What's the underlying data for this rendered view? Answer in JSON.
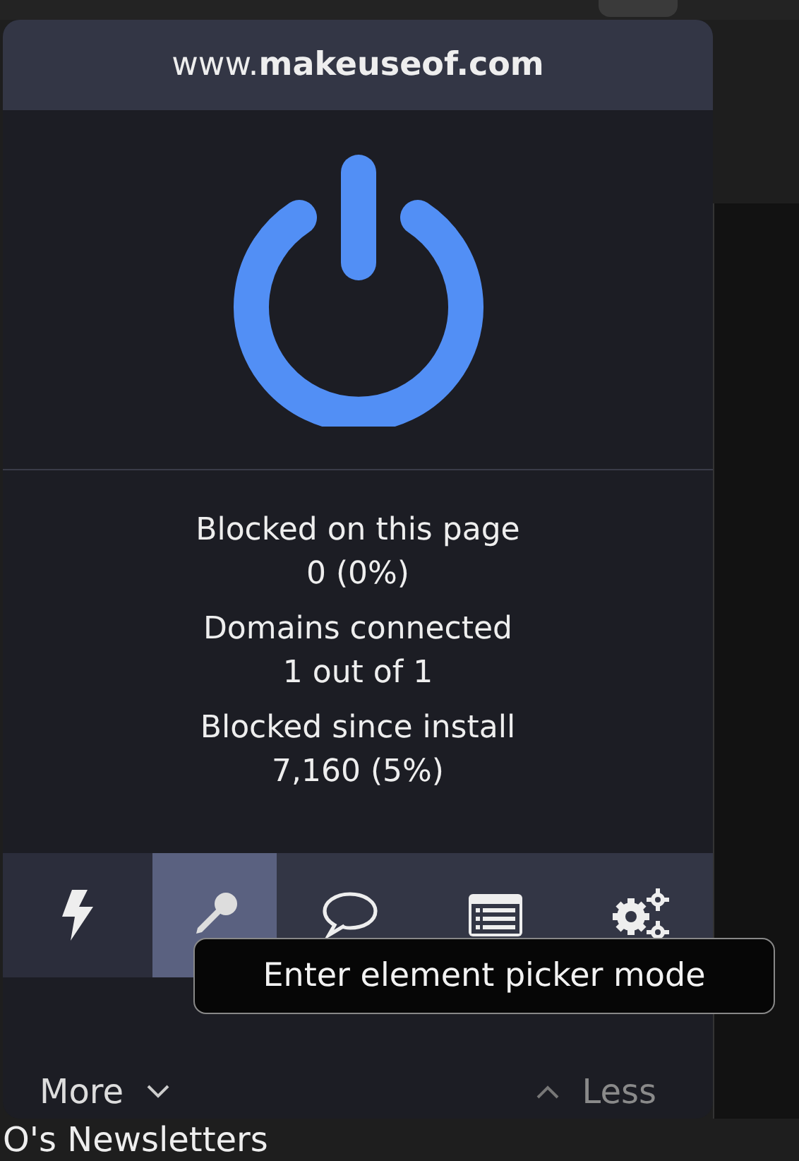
{
  "popup": {
    "hostname": "www.**makeuseof.com**",
    "power": {
      "on": true
    },
    "stats": [
      {
        "label": "Blocked on this page",
        "value": "0 (0%)"
      },
      {
        "label": "Domains connected",
        "value": "1 out of 1"
      },
      {
        "label": "Blocked since install",
        "value": "7,160 (5%)"
      }
    ],
    "tools": [
      {
        "kind": "zap",
        "selected": false
      },
      {
        "kind": "picker",
        "selected": true
      },
      {
        "kind": "chat",
        "selected": false
      },
      {
        "kind": "list",
        "selected": false
      },
      {
        "kind": "settings",
        "selected": false
      }
    ],
    "more": "More",
    "less": "Less"
  },
  "tooltip": "Enter element picker mode",
  "page_text": "O's Newsletters"
}
